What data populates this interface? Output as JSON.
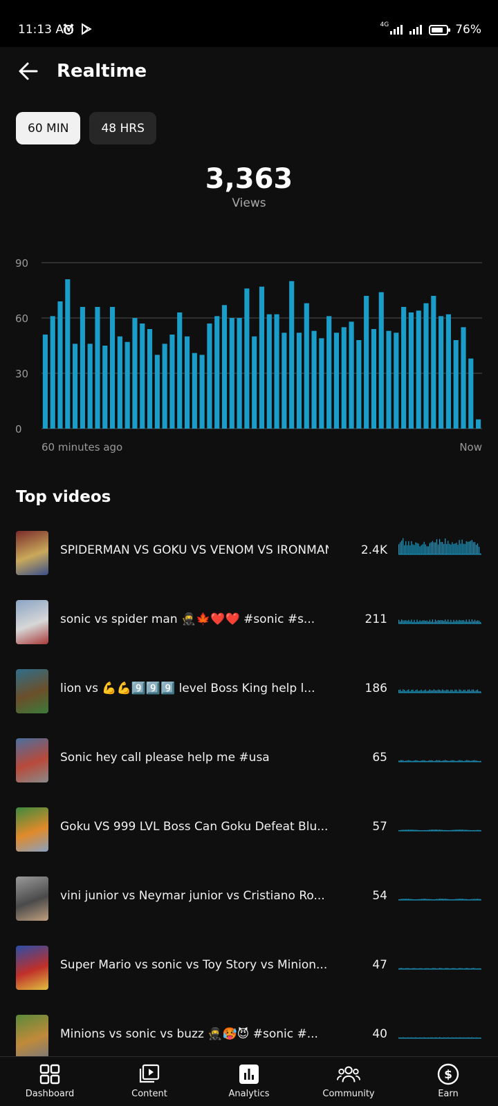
{
  "status_bar": {
    "time": "11:13 AM",
    "battery": "76%",
    "network": "4G"
  },
  "header": {
    "title": "Realtime"
  },
  "tabs": [
    {
      "label": "60 MIN",
      "active": true
    },
    {
      "label": "48 HRS",
      "active": false
    }
  ],
  "summary": {
    "value": "3,363",
    "label": "Views"
  },
  "chart_data": {
    "type": "bar",
    "x_start_label": "60 minutes ago",
    "x_end_label": "Now",
    "y_ticks": [
      "0",
      "30",
      "60",
      "90"
    ],
    "ylim": [
      0,
      90
    ],
    "color": "#1a9ec9",
    "values": [
      51,
      61,
      69,
      81,
      46,
      66,
      46,
      66,
      45,
      66,
      50,
      47,
      60,
      57,
      54,
      40,
      46,
      51,
      63,
      50,
      41,
      40,
      57,
      61,
      67,
      60,
      60,
      76,
      50,
      77,
      62,
      62,
      52,
      80,
      52,
      68,
      53,
      49,
      61,
      52,
      55,
      58,
      48,
      72,
      54,
      74,
      53,
      52,
      66,
      63,
      64,
      68,
      72,
      61,
      62,
      48,
      55,
      38,
      5
    ]
  },
  "top_videos": {
    "title": "Top videos",
    "items": [
      {
        "title": "SPIDERMAN VS GOKU VS VENOM VS IRONMAN...",
        "views": "2.4K",
        "thumb": [
          "#7a2b2b",
          "#c9a95a",
          "#3a4f8a"
        ],
        "level": 1.0
      },
      {
        "title": "sonic vs spider man 🥷🍁❤️❤️ #sonic #s...",
        "views": "211",
        "thumb": [
          "#8aa4c4",
          "#d7d7d7",
          "#a83a3a"
        ],
        "level": 0.12
      },
      {
        "title": "lion vs 💪💪9️⃣9️⃣9️⃣ level Boss King help l...",
        "views": "186",
        "thumb": [
          "#2f6e8a",
          "#6b4f2a",
          "#3b7a3b"
        ],
        "level": 0.1
      },
      {
        "title": "Sonic hey call please help me #usa",
        "views": "65",
        "thumb": [
          "#4a6fa0",
          "#b84a3a",
          "#8a8a8a"
        ],
        "level": 0.05
      },
      {
        "title": "Goku VS 999 LVL Boss Can Goku Defeat Blu...",
        "views": "57",
        "thumb": [
          "#3e8a3e",
          "#e08a2a",
          "#8aa0c0"
        ],
        "level": 0.04
      },
      {
        "title": "vini junior vs Neymar junior vs Cristiano Ro...",
        "views": "54",
        "thumb": [
          "#9a9a9a",
          "#4a4a4a",
          "#c0a080"
        ],
        "level": 0.04
      },
      {
        "title": "Super Mario vs sonic vs Toy Story vs Minion...",
        "views": "47",
        "thumb": [
          "#2a4ea8",
          "#c0302a",
          "#e0c040"
        ],
        "level": 0.035
      },
      {
        "title": "Minions vs sonic vs buzz 🥷🥵😈 #sonic #...",
        "views": "40",
        "thumb": [
          "#5a8a3a",
          "#c08a3a",
          "#7a7a7a"
        ],
        "level": 0.03
      }
    ]
  },
  "bottom_nav": [
    {
      "label": "Dashboard",
      "icon": "dashboard-icon"
    },
    {
      "label": "Content",
      "icon": "content-icon"
    },
    {
      "label": "Analytics",
      "icon": "analytics-icon"
    },
    {
      "label": "Community",
      "icon": "community-icon"
    },
    {
      "label": "Earn",
      "icon": "earn-icon"
    }
  ]
}
